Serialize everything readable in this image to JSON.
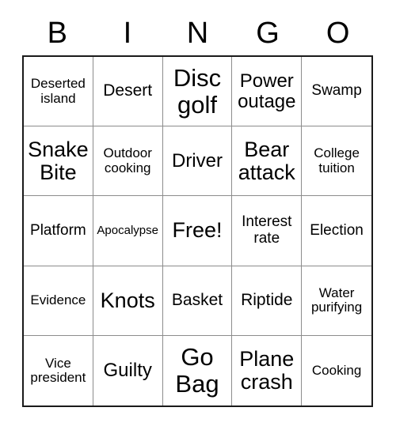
{
  "card": {
    "title": "BINGO",
    "header_letters": [
      "B",
      "I",
      "N",
      "G",
      "O"
    ],
    "grid_size": "5x5",
    "free_space_label": "Free!",
    "free_space_position": "row3-col3",
    "colors": {
      "background": "#ffffff",
      "text": "#000000",
      "outer_border": "#1a1a1a",
      "inner_border": "#8c8c8c"
    },
    "rows": [
      [
        {
          "label": "Deserted island",
          "size": "fs-s"
        },
        {
          "label": "Desert",
          "size": "fs-ml"
        },
        {
          "label": "Disc golf",
          "size": "fs-xxl"
        },
        {
          "label": "Power outage",
          "size": "fs-l"
        },
        {
          "label": "Swamp",
          "size": "fs-m"
        }
      ],
      [
        {
          "label": "Snake Bite",
          "size": "fs-xl"
        },
        {
          "label": "Outdoor cooking",
          "size": "fs-s"
        },
        {
          "label": "Driver",
          "size": "fs-l"
        },
        {
          "label": "Bear attack",
          "size": "fs-xl"
        },
        {
          "label": "College tuition",
          "size": "fs-s"
        }
      ],
      [
        {
          "label": "Platform",
          "size": "fs-m"
        },
        {
          "label": "Apocalypse",
          "size": "fs-xs"
        },
        {
          "label": "Free!",
          "size": "fs-xl"
        },
        {
          "label": "Interest rate",
          "size": "fs-m"
        },
        {
          "label": "Election",
          "size": "fs-m"
        }
      ],
      [
        {
          "label": "Evidence",
          "size": "fs-s"
        },
        {
          "label": "Knots",
          "size": "fs-xl"
        },
        {
          "label": "Basket",
          "size": "fs-ml"
        },
        {
          "label": "Riptide",
          "size": "fs-ml"
        },
        {
          "label": "Water purifying",
          "size": "fs-s"
        }
      ],
      [
        {
          "label": "Vice president",
          "size": "fs-s"
        },
        {
          "label": "Guilty",
          "size": "fs-l"
        },
        {
          "label": "Go Bag",
          "size": "fs-xxl"
        },
        {
          "label": "Plane crash",
          "size": "fs-xl"
        },
        {
          "label": "Cooking",
          "size": "fs-s"
        }
      ]
    ]
  }
}
